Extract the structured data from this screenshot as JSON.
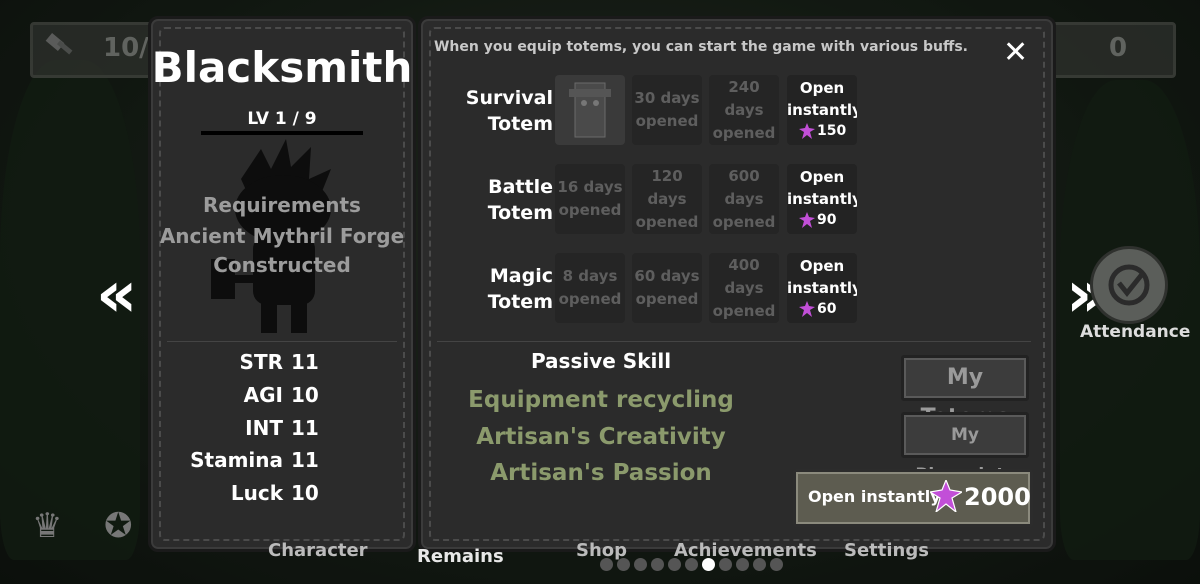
{
  "top": {
    "left_count": "10/",
    "right_count": "0"
  },
  "job": {
    "title": "Blacksmith",
    "level": "LV 1 / 9",
    "requirements_heading": "Requirements",
    "requirement_line1": "Ancient Mythril Forge",
    "requirement_line2": "Constructed"
  },
  "stats": [
    {
      "name": "STR",
      "value": "11"
    },
    {
      "name": "AGI",
      "value": "10"
    },
    {
      "name": "INT",
      "value": "11"
    },
    {
      "name": "Stamina",
      "value": "11"
    },
    {
      "name": "Luck",
      "value": "10"
    }
  ],
  "totems": {
    "subtitle": "When you equip totems, you can start the game with various buffs.",
    "rows": [
      {
        "name_line1": "Survival",
        "name_line2": "Totem",
        "options": [
          {
            "line1": "",
            "line2": ""
          },
          {
            "line1": "30 days",
            "line2": "opened"
          },
          {
            "line1": "240 days",
            "line2": "opened"
          }
        ],
        "open_label": "Open instantly",
        "open_price": "150"
      },
      {
        "name_line1": "Battle",
        "name_line2": "Totem",
        "options": [
          {
            "line1": "16 days",
            "line2": "opened"
          },
          {
            "line1": "120 days",
            "line2": "opened"
          },
          {
            "line1": "600 days",
            "line2": "opened"
          }
        ],
        "open_label": "Open instantly",
        "open_price": "90"
      },
      {
        "name_line1": "Magic",
        "name_line2": "Totem",
        "options": [
          {
            "line1": "8 days",
            "line2": "opened"
          },
          {
            "line1": "60 days",
            "line2": "opened"
          },
          {
            "line1": "400 days",
            "line2": "opened"
          }
        ],
        "open_label": "Open instantly",
        "open_price": "60"
      }
    ]
  },
  "passive": {
    "title": "Passive Skill",
    "skills": [
      "Equipment recycling",
      "Artisan's Creativity",
      "Artisan's Passion"
    ]
  },
  "buttons": {
    "my_totems": "My Totems",
    "my_blueprints": "My Blueprints",
    "open_instantly": "Open instantly",
    "open_instantly_price": "2000",
    "close": "✕"
  },
  "side": {
    "left_arrow": "«",
    "right_arrow": "»",
    "attendance": "Attendance"
  },
  "bottom_nav": [
    "Character",
    "Remains",
    "Shop",
    "Achievements",
    "Settings"
  ],
  "page_dots": {
    "count": 11,
    "active_index": 6
  },
  "colors": {
    "gem": "#c24fd8",
    "skill_green": "#8b9a6c",
    "panel": "#2b2b2b"
  }
}
